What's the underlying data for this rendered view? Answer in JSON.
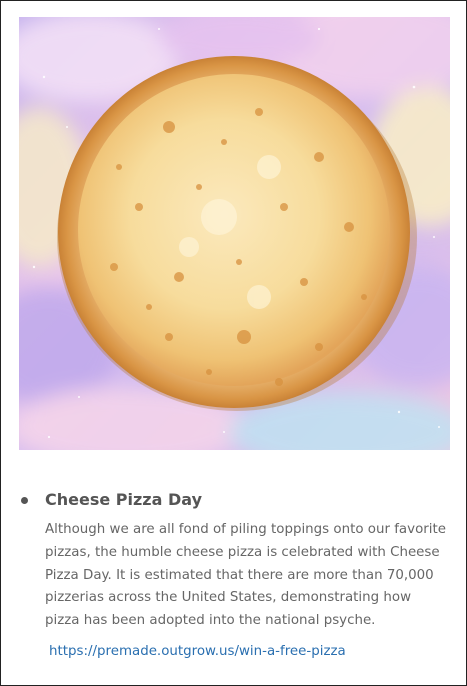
{
  "card": {
    "image_alt": "Cheese pizza on pastel galaxy clouds",
    "title": "Cheese Pizza Day",
    "body": "Although we are all fond of piling toppings onto our favorite pizzas, the humble cheese pizza is celebrated with Cheese Pizza Day. It is estimated that there are more than 70,000 pizzerias across the United States, demonstrating how pizza has been adopted into the national psyche.",
    "link": "https://premade.outgrow.us/win-a-free-pizza"
  },
  "colors": {
    "title": "#555555",
    "body": "#666666",
    "link": "#2a6fb0",
    "crust": "#e3a55a",
    "cheese": "#f7dc9c"
  }
}
